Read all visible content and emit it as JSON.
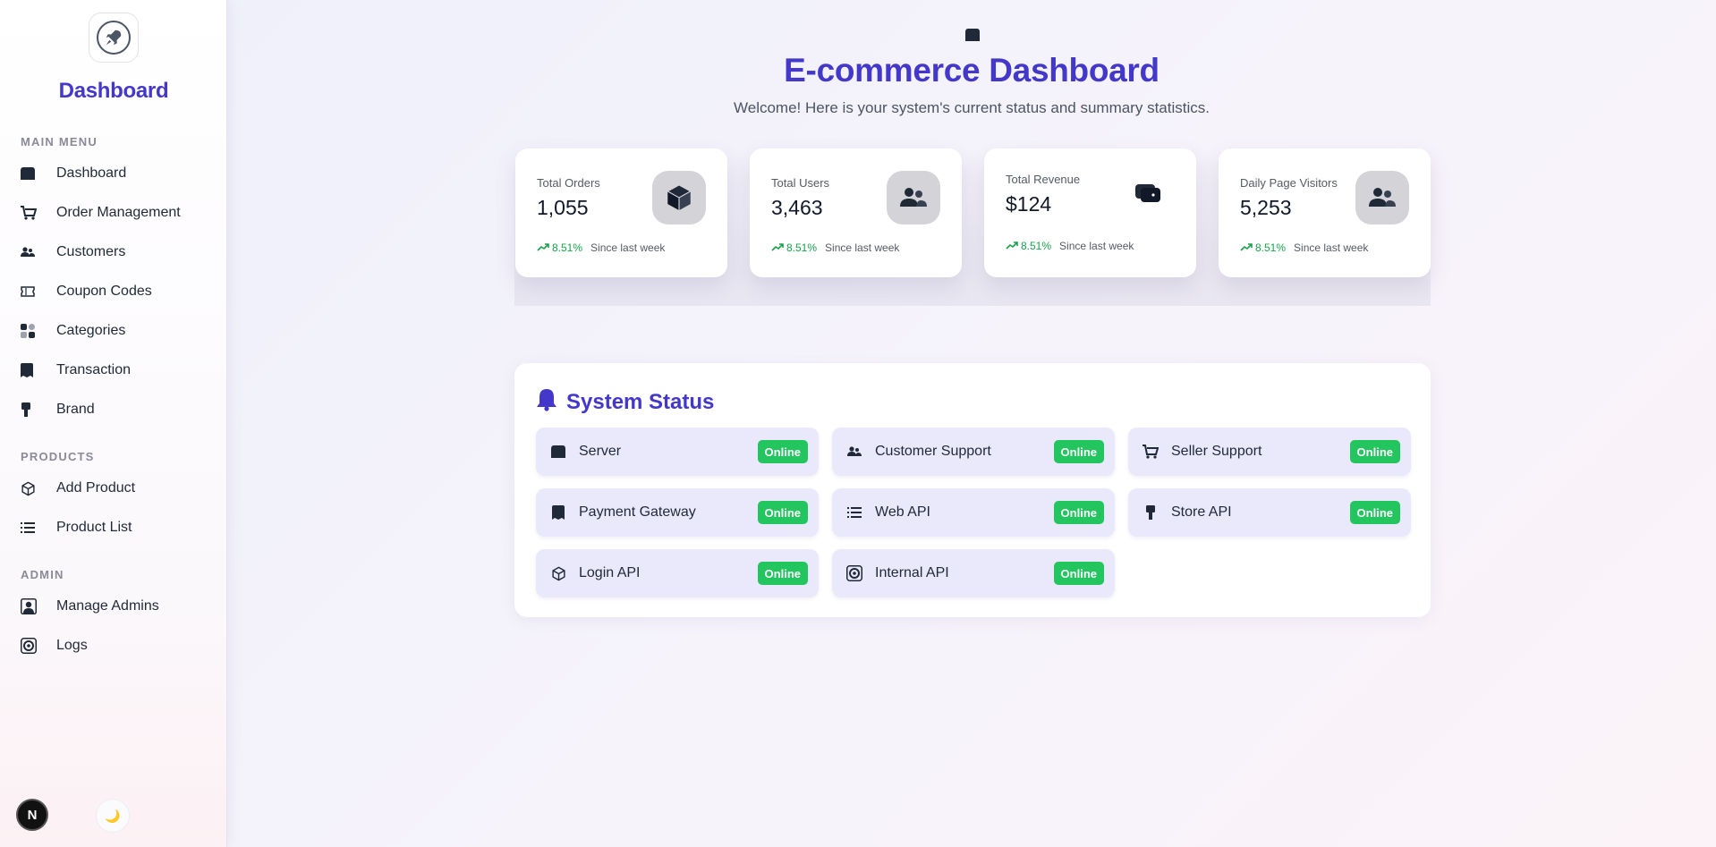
{
  "sidebar": {
    "brand": "Dashboard",
    "sections": {
      "main": "MAIN MENU",
      "products": "PRODUCTS",
      "admin": "ADMIN"
    },
    "main_items": [
      {
        "label": "Dashboard",
        "icon": "dashboard-icon"
      },
      {
        "label": "Order Management",
        "icon": "cart-icon"
      },
      {
        "label": "Customers",
        "icon": "users-icon"
      },
      {
        "label": "Coupon Codes",
        "icon": "ticket-icon"
      },
      {
        "label": "Categories",
        "icon": "categories-icon"
      },
      {
        "label": "Transaction",
        "icon": "receipt-icon"
      },
      {
        "label": "Brand",
        "icon": "pin-icon"
      }
    ],
    "product_items": [
      {
        "label": "Add Product",
        "icon": "box-icon"
      },
      {
        "label": "Product List",
        "icon": "list-icon"
      }
    ],
    "admin_items": [
      {
        "label": "Manage Admins",
        "icon": "admin-icon"
      },
      {
        "label": "Logs",
        "icon": "logs-icon"
      }
    ],
    "theme_badge": "N",
    "moon_icon": "🌙"
  },
  "header": {
    "title": "E-commerce Dashboard",
    "subtitle": "Welcome! Here is your system's current status and summary statistics."
  },
  "stats": [
    {
      "label": "Total Orders",
      "value": "1,055",
      "trend": "8.51%",
      "since": "Since last week",
      "icon": "cube-icon"
    },
    {
      "label": "Total Users",
      "value": "3,463",
      "trend": "8.51%",
      "since": "Since last week",
      "icon": "users-icon"
    },
    {
      "label": "Total Revenue",
      "value": "$124",
      "trend": "8.51%",
      "since": "Since last week",
      "icon": "wallet-icon"
    },
    {
      "label": "Daily Page Visitors",
      "value": "5,253",
      "trend": "8.51%",
      "since": "Since last week",
      "icon": "users-icon"
    }
  ],
  "status": {
    "title": "System Status",
    "items": [
      {
        "name": "Server",
        "status": "Online",
        "icon": "dashboard-icon"
      },
      {
        "name": "Customer Support",
        "status": "Online",
        "icon": "users-icon"
      },
      {
        "name": "Seller Support",
        "status": "Online",
        "icon": "cart-icon"
      },
      {
        "name": "Payment Gateway",
        "status": "Online",
        "icon": "receipt-icon"
      },
      {
        "name": "Web API",
        "status": "Online",
        "icon": "list-icon"
      },
      {
        "name": "Store API",
        "status": "Online",
        "icon": "pin-icon"
      },
      {
        "name": "Login API",
        "status": "Online",
        "icon": "box-icon"
      },
      {
        "name": "Internal API",
        "status": "Online",
        "icon": "logs-icon"
      }
    ]
  },
  "colors": {
    "accent": "#4338ca",
    "online": "#22c55e",
    "trend": "#16a34a"
  }
}
